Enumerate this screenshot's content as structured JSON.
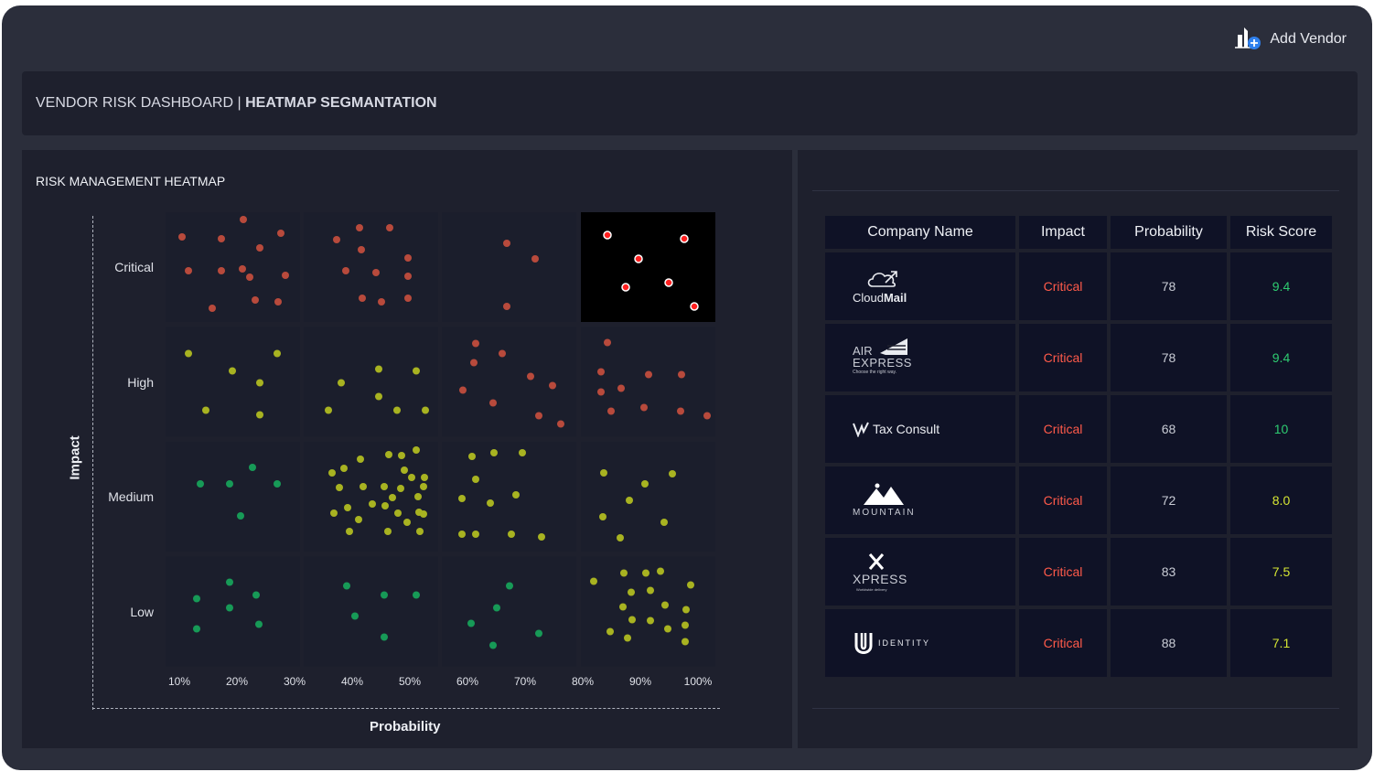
{
  "header": {
    "add_vendor_label": "Add Vendor",
    "title_prefix": "VENDOR RISK DASHBOARD | ",
    "title_bold": "HEATMAP SEGMANTATION"
  },
  "heatmap": {
    "title": "RISK MANAGEMENT HEATMAP",
    "y_axis_title": "Impact",
    "x_axis_title": "Probability",
    "rows": [
      "Critical",
      "High",
      "Medium",
      "Low"
    ],
    "x_ticks": [
      "10%",
      "20%",
      "30%",
      "40%",
      "50%",
      "60%",
      "70%",
      "80%",
      "90%",
      "100%"
    ],
    "highlighted_cell": {
      "row": "Critical",
      "column": 4
    },
    "colors": {
      "cell_bg": "#1b1e2c",
      "highlight_bg": "#000000",
      "red": "#b84a3c",
      "bright_red": "#ff1f1f",
      "olive": "#a8b321",
      "green": "#179a57"
    }
  },
  "table": {
    "headers": [
      "Company Name",
      "Impact",
      "Probability",
      "Risk Score"
    ],
    "rows": [
      {
        "company": "CloudMail",
        "logo_icon": "cloudmail-logo",
        "logo_parts": [
          "Cloud",
          "Mail"
        ],
        "impact": "Critical",
        "probability": "78",
        "risk_score": "9.4",
        "score_color": "#2ecc71"
      },
      {
        "company": "Air Express",
        "logo_icon": "air-express-logo",
        "logo_parts": [
          "AIR",
          "EXPRESS",
          "Choose the right way."
        ],
        "impact": "Critical",
        "probability": "78",
        "risk_score": "9.4",
        "score_color": "#2ecc71"
      },
      {
        "company": "Tax Consult",
        "logo_icon": "tax-consult-logo",
        "logo_parts": [
          "Tax Consult"
        ],
        "impact": "Critical",
        "probability": "68",
        "risk_score": "10",
        "score_color": "#2ecc71"
      },
      {
        "company": "Mountain",
        "logo_icon": "mountain-logo",
        "logo_parts": [
          "MOUNTAIN"
        ],
        "impact": "Critical",
        "probability": "72",
        "risk_score": "8.0",
        "score_color": "#d5e533"
      },
      {
        "company": "Xpress",
        "logo_icon": "xpress-logo",
        "logo_parts": [
          "XPRESS",
          "Worldwide delivery"
        ],
        "impact": "Critical",
        "probability": "83",
        "risk_score": "7.5",
        "score_color": "#d5e533"
      },
      {
        "company": "Identity",
        "logo_icon": "identity-logo",
        "logo_parts": [
          "IDENTITY"
        ],
        "impact": "Critical",
        "probability": "88",
        "risk_score": "7.1",
        "score_color": "#d5e533"
      }
    ],
    "impact_color": "#ff5a4a"
  }
}
